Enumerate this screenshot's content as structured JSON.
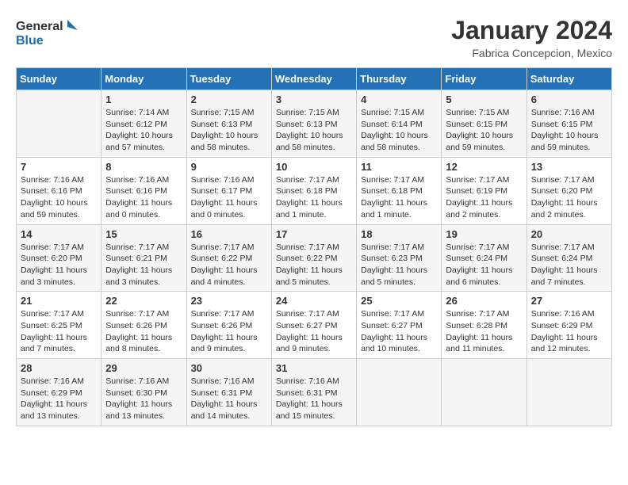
{
  "header": {
    "logo_line1": "General",
    "logo_line2": "Blue",
    "month": "January 2024",
    "location": "Fabrica Concepcion, Mexico"
  },
  "weekdays": [
    "Sunday",
    "Monday",
    "Tuesday",
    "Wednesday",
    "Thursday",
    "Friday",
    "Saturday"
  ],
  "weeks": [
    [
      {
        "day": "",
        "sunrise": "",
        "sunset": "",
        "daylight": ""
      },
      {
        "day": "1",
        "sunrise": "Sunrise: 7:14 AM",
        "sunset": "Sunset: 6:12 PM",
        "daylight": "Daylight: 10 hours and 57 minutes."
      },
      {
        "day": "2",
        "sunrise": "Sunrise: 7:15 AM",
        "sunset": "Sunset: 6:13 PM",
        "daylight": "Daylight: 10 hours and 58 minutes."
      },
      {
        "day": "3",
        "sunrise": "Sunrise: 7:15 AM",
        "sunset": "Sunset: 6:13 PM",
        "daylight": "Daylight: 10 hours and 58 minutes."
      },
      {
        "day": "4",
        "sunrise": "Sunrise: 7:15 AM",
        "sunset": "Sunset: 6:14 PM",
        "daylight": "Daylight: 10 hours and 58 minutes."
      },
      {
        "day": "5",
        "sunrise": "Sunrise: 7:15 AM",
        "sunset": "Sunset: 6:15 PM",
        "daylight": "Daylight: 10 hours and 59 minutes."
      },
      {
        "day": "6",
        "sunrise": "Sunrise: 7:16 AM",
        "sunset": "Sunset: 6:15 PM",
        "daylight": "Daylight: 10 hours and 59 minutes."
      }
    ],
    [
      {
        "day": "7",
        "sunrise": "Sunrise: 7:16 AM",
        "sunset": "Sunset: 6:16 PM",
        "daylight": "Daylight: 10 hours and 59 minutes."
      },
      {
        "day": "8",
        "sunrise": "Sunrise: 7:16 AM",
        "sunset": "Sunset: 6:16 PM",
        "daylight": "Daylight: 11 hours and 0 minutes."
      },
      {
        "day": "9",
        "sunrise": "Sunrise: 7:16 AM",
        "sunset": "Sunset: 6:17 PM",
        "daylight": "Daylight: 11 hours and 0 minutes."
      },
      {
        "day": "10",
        "sunrise": "Sunrise: 7:17 AM",
        "sunset": "Sunset: 6:18 PM",
        "daylight": "Daylight: 11 hours and 1 minute."
      },
      {
        "day": "11",
        "sunrise": "Sunrise: 7:17 AM",
        "sunset": "Sunset: 6:18 PM",
        "daylight": "Daylight: 11 hours and 1 minute."
      },
      {
        "day": "12",
        "sunrise": "Sunrise: 7:17 AM",
        "sunset": "Sunset: 6:19 PM",
        "daylight": "Daylight: 11 hours and 2 minutes."
      },
      {
        "day": "13",
        "sunrise": "Sunrise: 7:17 AM",
        "sunset": "Sunset: 6:20 PM",
        "daylight": "Daylight: 11 hours and 2 minutes."
      }
    ],
    [
      {
        "day": "14",
        "sunrise": "Sunrise: 7:17 AM",
        "sunset": "Sunset: 6:20 PM",
        "daylight": "Daylight: 11 hours and 3 minutes."
      },
      {
        "day": "15",
        "sunrise": "Sunrise: 7:17 AM",
        "sunset": "Sunset: 6:21 PM",
        "daylight": "Daylight: 11 hours and 3 minutes."
      },
      {
        "day": "16",
        "sunrise": "Sunrise: 7:17 AM",
        "sunset": "Sunset: 6:22 PM",
        "daylight": "Daylight: 11 hours and 4 minutes."
      },
      {
        "day": "17",
        "sunrise": "Sunrise: 7:17 AM",
        "sunset": "Sunset: 6:22 PM",
        "daylight": "Daylight: 11 hours and 5 minutes."
      },
      {
        "day": "18",
        "sunrise": "Sunrise: 7:17 AM",
        "sunset": "Sunset: 6:23 PM",
        "daylight": "Daylight: 11 hours and 5 minutes."
      },
      {
        "day": "19",
        "sunrise": "Sunrise: 7:17 AM",
        "sunset": "Sunset: 6:24 PM",
        "daylight": "Daylight: 11 hours and 6 minutes."
      },
      {
        "day": "20",
        "sunrise": "Sunrise: 7:17 AM",
        "sunset": "Sunset: 6:24 PM",
        "daylight": "Daylight: 11 hours and 7 minutes."
      }
    ],
    [
      {
        "day": "21",
        "sunrise": "Sunrise: 7:17 AM",
        "sunset": "Sunset: 6:25 PM",
        "daylight": "Daylight: 11 hours and 7 minutes."
      },
      {
        "day": "22",
        "sunrise": "Sunrise: 7:17 AM",
        "sunset": "Sunset: 6:26 PM",
        "daylight": "Daylight: 11 hours and 8 minutes."
      },
      {
        "day": "23",
        "sunrise": "Sunrise: 7:17 AM",
        "sunset": "Sunset: 6:26 PM",
        "daylight": "Daylight: 11 hours and 9 minutes."
      },
      {
        "day": "24",
        "sunrise": "Sunrise: 7:17 AM",
        "sunset": "Sunset: 6:27 PM",
        "daylight": "Daylight: 11 hours and 9 minutes."
      },
      {
        "day": "25",
        "sunrise": "Sunrise: 7:17 AM",
        "sunset": "Sunset: 6:27 PM",
        "daylight": "Daylight: 11 hours and 10 minutes."
      },
      {
        "day": "26",
        "sunrise": "Sunrise: 7:17 AM",
        "sunset": "Sunset: 6:28 PM",
        "daylight": "Daylight: 11 hours and 11 minutes."
      },
      {
        "day": "27",
        "sunrise": "Sunrise: 7:16 AM",
        "sunset": "Sunset: 6:29 PM",
        "daylight": "Daylight: 11 hours and 12 minutes."
      }
    ],
    [
      {
        "day": "28",
        "sunrise": "Sunrise: 7:16 AM",
        "sunset": "Sunset: 6:29 PM",
        "daylight": "Daylight: 11 hours and 13 minutes."
      },
      {
        "day": "29",
        "sunrise": "Sunrise: 7:16 AM",
        "sunset": "Sunset: 6:30 PM",
        "daylight": "Daylight: 11 hours and 13 minutes."
      },
      {
        "day": "30",
        "sunrise": "Sunrise: 7:16 AM",
        "sunset": "Sunset: 6:31 PM",
        "daylight": "Daylight: 11 hours and 14 minutes."
      },
      {
        "day": "31",
        "sunrise": "Sunrise: 7:16 AM",
        "sunset": "Sunset: 6:31 PM",
        "daylight": "Daylight: 11 hours and 15 minutes."
      },
      {
        "day": "",
        "sunrise": "",
        "sunset": "",
        "daylight": ""
      },
      {
        "day": "",
        "sunrise": "",
        "sunset": "",
        "daylight": ""
      },
      {
        "day": "",
        "sunrise": "",
        "sunset": "",
        "daylight": ""
      }
    ]
  ]
}
